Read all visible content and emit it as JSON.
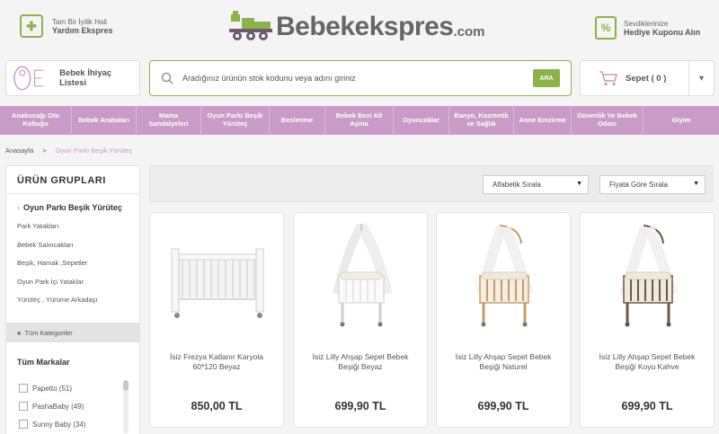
{
  "header": {
    "help_small": "Tam Bir İyilik Hali",
    "help_big": "Yardım Ekspres",
    "logo_text": "Bebekekspres",
    "logo_domain": ".com",
    "gift_small": "Sevdiklerinize",
    "gift_big": "Hediye Kuponu Alın"
  },
  "toolbar": {
    "list_label": "Bebek İhiyaç Listesi",
    "search_placeholder": "Aradığınız ürünün stok kodunu veya adını giriniz",
    "search_button": "ARA",
    "cart_label": "Sepet ( 0 )"
  },
  "categories": [
    "Anakucağı Oto Koltuğu",
    "Bebek Arabaları",
    "Mama Sandalyeleri",
    "Oyun Parkı Beşik Yürüteç",
    "Beslenme",
    "Bebek Bezi Alt Açma",
    "Oyuncaklar",
    "Banyo, Kozmetik ve Sağlık",
    "Anne Emzirme",
    "Güvenlik Ve Bebek Odası",
    "Giyim"
  ],
  "breadcrumb": {
    "home": "Anasayfa",
    "separator": ">",
    "current": "Oyun Parkı Beşik Yürüteç"
  },
  "sidebar": {
    "title": "ÜRÜN GRUPLARI",
    "active_category": "Oyun Parkı Beşik Yürüteç",
    "subcategories": [
      "Park Yatakları",
      "Bebek Salıncakları",
      "Beşik, Hamak ,Sepetler",
      "Oyun Park İçi Yataklar",
      "Yürüteç , Yürüme Arkadaşı"
    ],
    "all_categories": "Tüm Kategoriler",
    "brands_title": "Tüm Markalar",
    "brands": [
      "Papetto (51)",
      "PashaBaby (49)",
      "Sunny Baby (34)"
    ]
  },
  "sort": {
    "alpha": "Alfabetik Sırala",
    "price": "Fiyata Göre Sırala"
  },
  "products": [
    {
      "name": "İsiz Frezya Katlanır Karyola 60*120 Beyaz",
      "price": "850,00 TL",
      "color": "#f2f2f2"
    },
    {
      "name": "İsiz Lilly Ahşap Sepet Bebek Beşiği Beyaz",
      "price": "699,90 TL",
      "color": "#f2f2f2"
    },
    {
      "name": "İsiz Lilly Ahşap Sepet Bebek Beşiği Naturel",
      "price": "699,90 TL",
      "color": "#c89a6c"
    },
    {
      "name": "İsiz Lilly Ahşap Sepet Bebek Beşiği Koyu Kahve",
      "price": "699,90 TL",
      "color": "#6e5844"
    }
  ],
  "colors": {
    "accent_green": "#8bb348",
    "nav_purple": "#c99cc7"
  }
}
